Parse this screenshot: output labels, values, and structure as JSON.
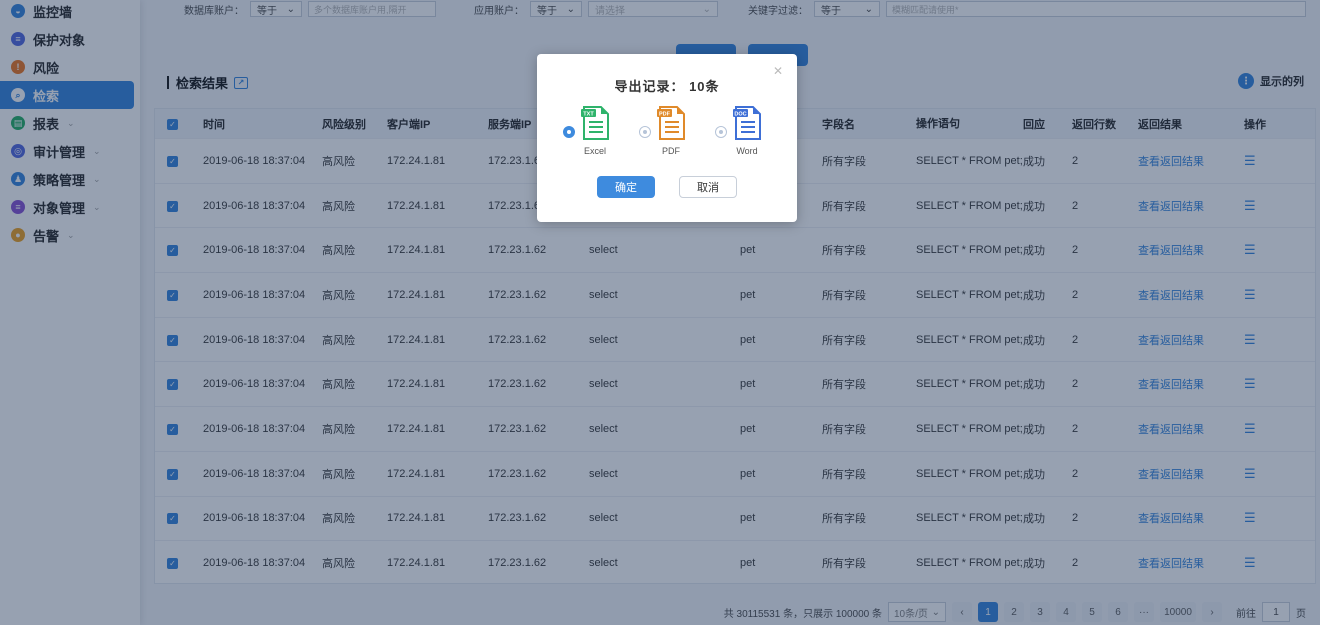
{
  "sidebar": {
    "items": [
      {
        "label": "监控墙",
        "icon": "monitor-icon",
        "color": "#3e8bde",
        "glyph": "◒",
        "expandable": false
      },
      {
        "label": "保护对象",
        "icon": "database-icon",
        "color": "#5b6ee1",
        "glyph": "≡",
        "expandable": false
      },
      {
        "label": "风险",
        "icon": "warning-icon",
        "color": "#f07d2a",
        "glyph": "!",
        "expandable": false
      },
      {
        "label": "检索",
        "icon": "search-icon",
        "color": "#3e8bde",
        "glyph": "⌕",
        "expandable": false,
        "active": true
      },
      {
        "label": "报表",
        "icon": "report-icon",
        "color": "#2fb36b",
        "glyph": "▤",
        "expandable": true
      },
      {
        "label": "审计管理",
        "icon": "audit-icon",
        "color": "#5b6ee1",
        "glyph": "◎",
        "expandable": true
      },
      {
        "label": "策略管理",
        "icon": "policy-icon",
        "color": "#3e8bde",
        "glyph": "♟",
        "expandable": true
      },
      {
        "label": "对象管理",
        "icon": "object-icon",
        "color": "#8e5bd6",
        "glyph": "≡",
        "expandable": true
      },
      {
        "label": "告警",
        "icon": "alarm-icon",
        "color": "#f0a62a",
        "glyph": "●",
        "expandable": true
      }
    ]
  },
  "filters": {
    "db_account_label": "数据库账户：",
    "db_account_op": "等于",
    "db_account_placeholder": "多个数据库账户用,隔开",
    "app_account_label": "应用账户：",
    "app_account_op": "等于",
    "app_account_placeholder": "请选择",
    "keyword_label": "关键字过滤：",
    "keyword_op": "等于",
    "keyword_placeholder": "模糊匹配请使用*"
  },
  "results": {
    "title": "检索结果",
    "show_columns_label": "显示的列"
  },
  "table": {
    "headers": [
      "时间",
      "风险级别",
      "客户端IP",
      "服务端IP",
      "",
      "",
      "字段名",
      "操作语句",
      "回应",
      "返回行数",
      "返回结果",
      "操作"
    ],
    "rows": [
      {
        "time": "2019-06-18 18:37:04",
        "risk": "高风险",
        "client_ip": "172.24.1.81",
        "server_ip": "172.23.1.62",
        "op_type": "",
        "object": "",
        "field": "所有字段",
        "stmt": "SELECT * FROM pet;",
        "resp": "成功",
        "rows": "2",
        "result": "查看返回结果"
      },
      {
        "time": "2019-06-18 18:37:04",
        "risk": "高风险",
        "client_ip": "172.24.1.81",
        "server_ip": "172.23.1.62",
        "op_type": "",
        "object": "",
        "field": "所有字段",
        "stmt": "SELECT * FROM pet;",
        "resp": "成功",
        "rows": "2",
        "result": "查看返回结果"
      },
      {
        "time": "2019-06-18 18:37:04",
        "risk": "高风险",
        "client_ip": "172.24.1.81",
        "server_ip": "172.23.1.62",
        "op_type": "select",
        "object": "pet",
        "field": "所有字段",
        "stmt": "SELECT * FROM pet;",
        "resp": "成功",
        "rows": "2",
        "result": "查看返回结果"
      },
      {
        "time": "2019-06-18 18:37:04",
        "risk": "高风险",
        "client_ip": "172.24.1.81",
        "server_ip": "172.23.1.62",
        "op_type": "select",
        "object": "pet",
        "field": "所有字段",
        "stmt": "SELECT * FROM pet;",
        "resp": "成功",
        "rows": "2",
        "result": "查看返回结果"
      },
      {
        "time": "2019-06-18 18:37:04",
        "risk": "高风险",
        "client_ip": "172.24.1.81",
        "server_ip": "172.23.1.62",
        "op_type": "select",
        "object": "pet",
        "field": "所有字段",
        "stmt": "SELECT * FROM pet;",
        "resp": "成功",
        "rows": "2",
        "result": "查看返回结果"
      },
      {
        "time": "2019-06-18 18:37:04",
        "risk": "高风险",
        "client_ip": "172.24.1.81",
        "server_ip": "172.23.1.62",
        "op_type": "select",
        "object": "pet",
        "field": "所有字段",
        "stmt": "SELECT * FROM pet;",
        "resp": "成功",
        "rows": "2",
        "result": "查看返回结果"
      },
      {
        "time": "2019-06-18 18:37:04",
        "risk": "高风险",
        "client_ip": "172.24.1.81",
        "server_ip": "172.23.1.62",
        "op_type": "select",
        "object": "pet",
        "field": "所有字段",
        "stmt": "SELECT * FROM pet;",
        "resp": "成功",
        "rows": "2",
        "result": "查看返回结果"
      },
      {
        "time": "2019-06-18 18:37:04",
        "risk": "高风险",
        "client_ip": "172.24.1.81",
        "server_ip": "172.23.1.62",
        "op_type": "select",
        "object": "pet",
        "field": "所有字段",
        "stmt": "SELECT * FROM pet;",
        "resp": "成功",
        "rows": "2",
        "result": "查看返回结果"
      },
      {
        "time": "2019-06-18 18:37:04",
        "risk": "高风险",
        "client_ip": "172.24.1.81",
        "server_ip": "172.23.1.62",
        "op_type": "select",
        "object": "pet",
        "field": "所有字段",
        "stmt": "SELECT * FROM pet;",
        "resp": "成功",
        "rows": "2",
        "result": "查看返回结果"
      },
      {
        "time": "2019-06-18 18:37:04",
        "risk": "高风险",
        "client_ip": "172.24.1.81",
        "server_ip": "172.23.1.62",
        "op_type": "select",
        "object": "pet",
        "field": "所有字段",
        "stmt": "SELECT * FROM pet;",
        "resp": "成功",
        "rows": "2",
        "result": "查看返回结果"
      }
    ]
  },
  "pagination": {
    "summary": "共 30115531 条，只展示 100000 条",
    "page_size": "10条/页",
    "pages": [
      "1",
      "2",
      "3",
      "4",
      "5",
      "6",
      "···",
      "10000"
    ],
    "current_page": "1",
    "goto_label": "前往",
    "goto_value": "1",
    "page_unit": "页"
  },
  "dialog": {
    "title": "导出记录： 10条",
    "formats": [
      {
        "label": "Excel",
        "icon": "excel-file-icon",
        "badge": "TXT",
        "color": "#2fb36b",
        "selected": true
      },
      {
        "label": "PDF",
        "icon": "pdf-file-icon",
        "badge": "PDF",
        "color": "#e08a2a",
        "selected": false
      },
      {
        "label": "Word",
        "icon": "word-file-icon",
        "badge": "DOC",
        "color": "#3e6fd6",
        "selected": false
      }
    ],
    "confirm_label": "确定",
    "cancel_label": "取消"
  },
  "colors": {
    "accent": "#3e8bde",
    "overlay": "rgba(8,30,70,0.42)"
  }
}
